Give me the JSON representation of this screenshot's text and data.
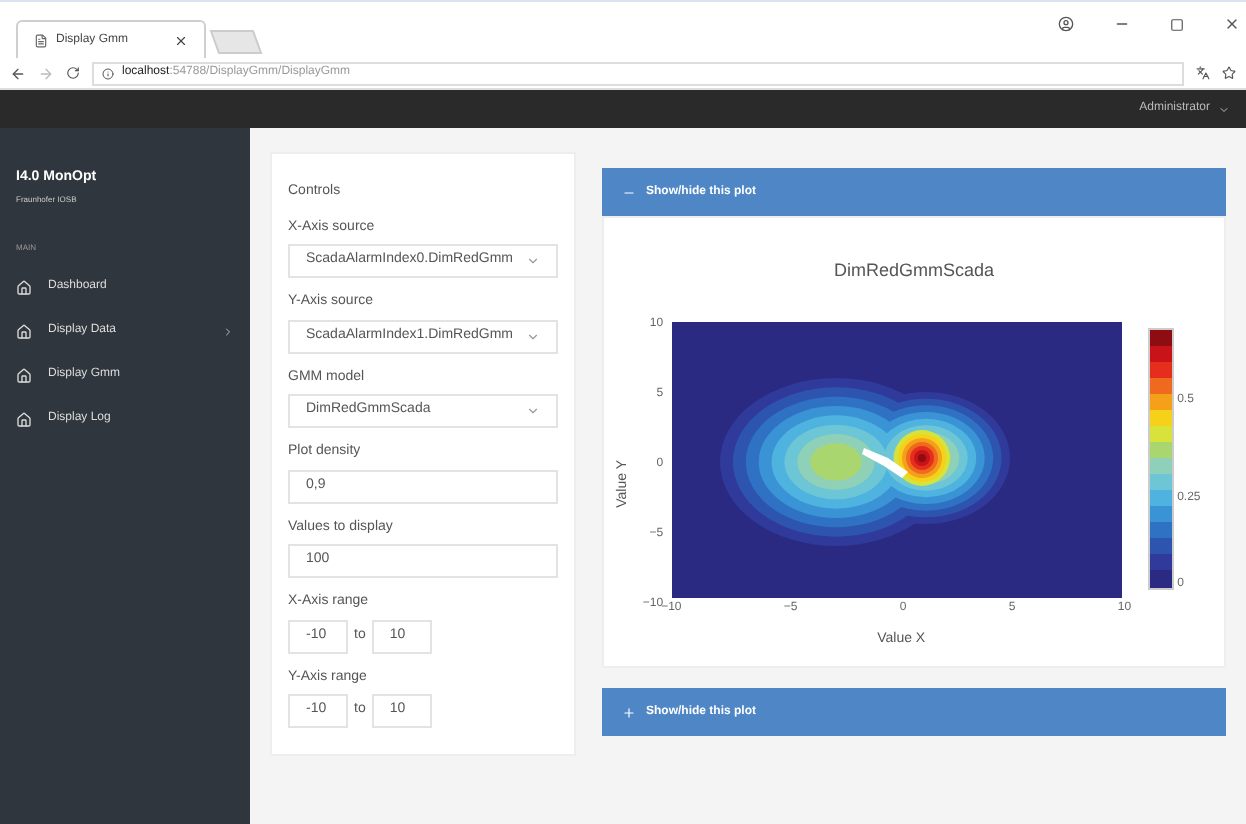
{
  "browser": {
    "tab_title": "Display Gmm",
    "url_host": "localhost",
    "url_path": ":54788/DisplayGmm/DisplayGmm"
  },
  "topbar": {
    "user": "Administrator"
  },
  "sidebar": {
    "title": "I4.0 MonOpt",
    "subtitle": "Fraunhofer IOSB",
    "section": "MAIN",
    "items": [
      {
        "label": "Dashboard",
        "has_submenu": false
      },
      {
        "label": "Display Data",
        "has_submenu": true
      },
      {
        "label": "Display Gmm",
        "has_submenu": false
      },
      {
        "label": "Display Log",
        "has_submenu": false
      }
    ]
  },
  "controls": {
    "title": "Controls",
    "fields": [
      {
        "kind": "select",
        "label": "X-Axis source",
        "value": "ScadaAlarmIndex0.DimRedGmm"
      },
      {
        "kind": "select",
        "label": "Y-Axis source",
        "value": "ScadaAlarmIndex1.DimRedGmm"
      },
      {
        "kind": "select",
        "label": "GMM model",
        "value": "DimRedGmmScada"
      },
      {
        "kind": "text",
        "label": "Plot density",
        "value": "0,9"
      },
      {
        "kind": "text",
        "label": "Values to display",
        "value": "100"
      },
      {
        "kind": "range",
        "label": "X-Axis range",
        "from": "-10",
        "joiner": "to",
        "to": "10"
      },
      {
        "kind": "range",
        "label": "Y-Axis range",
        "from": "-10",
        "joiner": "to",
        "to": "10"
      }
    ]
  },
  "panels": [
    {
      "header": "Show/hide this plot",
      "expanded": true,
      "plot": {
        "title": "DimRedGmmScada",
        "xlabel": "Value X",
        "ylabel": "Value Y",
        "xticks": [
          "−10",
          "−5",
          "0",
          "5",
          "10"
        ],
        "yticks": [
          "10",
          "5",
          "0",
          "−5",
          "−10"
        ],
        "colorbar_ticks": [
          "0.5",
          "0.25",
          "0"
        ]
      }
    },
    {
      "header": "Show/hide this plot",
      "expanded": false
    }
  ]
}
